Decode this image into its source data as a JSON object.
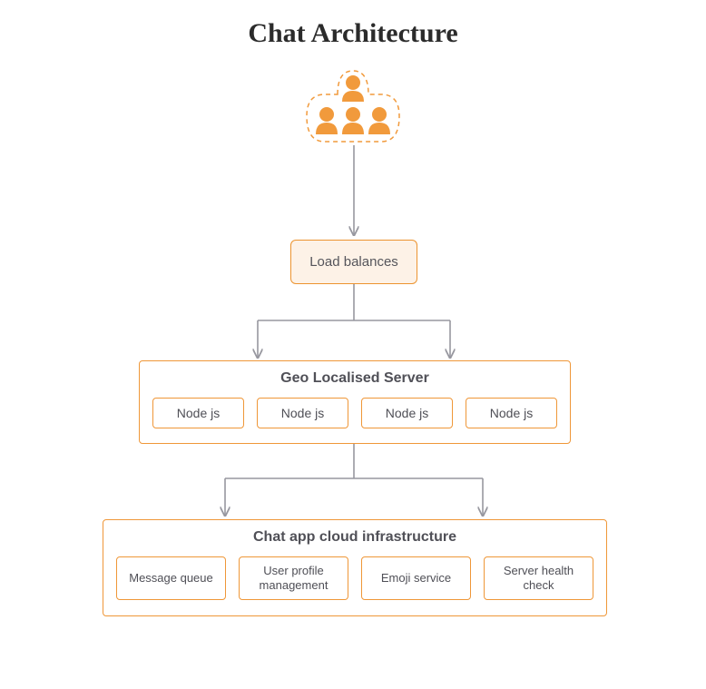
{
  "title": "Chat Architecture",
  "load_balancer": {
    "label": "Load balances"
  },
  "geo_server": {
    "title": "Geo Localised Server",
    "nodes": [
      "Node js",
      "Node js",
      "Node js",
      "Node js"
    ]
  },
  "cloud_infra": {
    "title": "Chat app cloud infrastructure",
    "services": [
      "Message queue",
      "User profile management",
      "Emoji service",
      "Server health check"
    ]
  },
  "colors": {
    "accent": "#ef9738",
    "accent_bg": "#fdf2e7",
    "arrow": "#97979f",
    "text": "#505057"
  }
}
